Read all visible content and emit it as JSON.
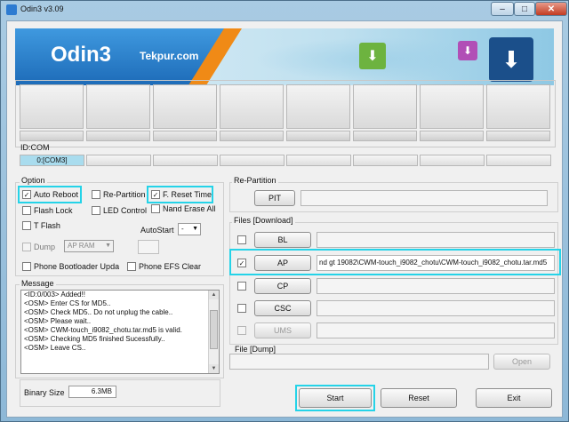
{
  "window": {
    "title": "Odin3 v3.09",
    "controls": {
      "minimize": "–",
      "maximize": "□",
      "close": "✕"
    }
  },
  "banner": {
    "logo": "Odin3",
    "brand": "Tekpur.com",
    "icons": [
      "download-green-icon",
      "download-purple-icon",
      "download-blue-icon"
    ]
  },
  "device": {
    "id_label": "ID:COM",
    "ports": [
      "0:[COM3]",
      "",
      "",
      "",
      "",
      "",
      "",
      ""
    ]
  },
  "options": {
    "title": "Option",
    "auto_reboot": {
      "label": "Auto Reboot",
      "checked": true
    },
    "re_partition": {
      "label": "Re-Partition",
      "checked": false
    },
    "f_reset_time": {
      "label": "F. Reset Time",
      "checked": true
    },
    "flash_lock": {
      "label": "Flash Lock",
      "checked": false
    },
    "led_control": {
      "label": "LED Control",
      "checked": false
    },
    "nand_erase_all": {
      "label": "Nand Erase All",
      "checked": false
    },
    "t_flash": {
      "label": "T Flash",
      "checked": false
    },
    "autostart_label": "AutoStart",
    "autostart_value": "-",
    "dump_label": "Dump",
    "dump_select": "AP RAM",
    "phone_bootloader": {
      "label": "Phone Bootloader Update",
      "checked": false
    },
    "phone_efs_clear": {
      "label": "Phone EFS Clear",
      "checked": false
    }
  },
  "message": {
    "title": "Message",
    "lines": [
      "<ID:0/003> Added!!",
      "<OSM> Enter CS for MD5..",
      "<OSM> Check MD5.. Do not unplug the cable..",
      "<OSM> Please wait..",
      "<OSM> CWM-touch_i9082_chotu.tar.md5 is valid.",
      "<OSM> Checking MD5 finished Sucessfully..",
      "<OSM> Leave CS.."
    ]
  },
  "repartition": {
    "title": "Re-Partition",
    "pit_label": "PIT"
  },
  "files": {
    "title": "Files [Download]",
    "rows": [
      {
        "label": "BL",
        "checked": false,
        "path": ""
      },
      {
        "label": "AP",
        "checked": true,
        "path": "nd gt 19082\\CWM-touch_i9082_chotu\\CWM-touch_i9082_chotu.tar.md5"
      },
      {
        "label": "CP",
        "checked": false,
        "path": ""
      },
      {
        "label": "CSC",
        "checked": false,
        "path": ""
      },
      {
        "label": "UMS",
        "checked": false,
        "path": ""
      }
    ]
  },
  "filedump": {
    "title": "File [Dump]",
    "open_label": "Open"
  },
  "binary": {
    "label": "Binary Size",
    "value": "6.3MB"
  },
  "actions": {
    "start": "Start",
    "reset": "Reset",
    "exit": "Exit"
  },
  "highlight_color": "#25d3e8"
}
